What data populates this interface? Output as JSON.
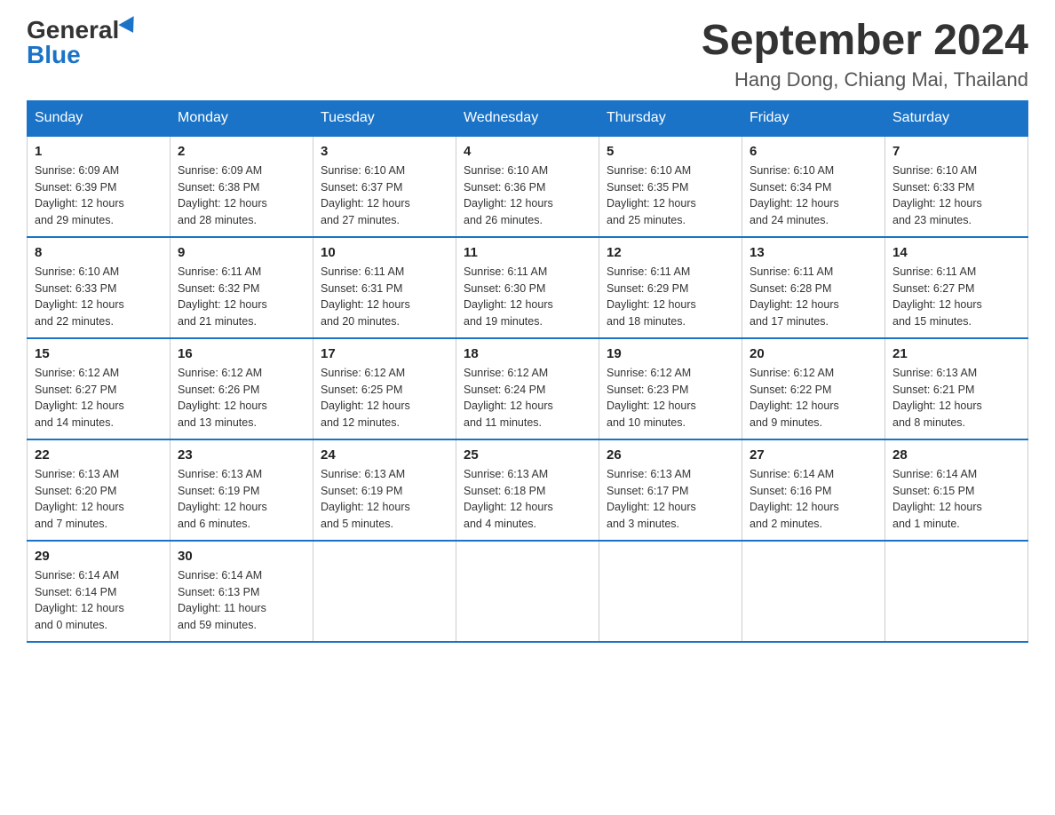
{
  "header": {
    "logo_general": "General",
    "logo_blue": "Blue",
    "month_title": "September 2024",
    "location": "Hang Dong, Chiang Mai, Thailand"
  },
  "weekdays": [
    "Sunday",
    "Monday",
    "Tuesday",
    "Wednesday",
    "Thursday",
    "Friday",
    "Saturday"
  ],
  "weeks": [
    [
      {
        "day": "1",
        "sunrise": "6:09 AM",
        "sunset": "6:39 PM",
        "daylight": "12 hours and 29 minutes."
      },
      {
        "day": "2",
        "sunrise": "6:09 AM",
        "sunset": "6:38 PM",
        "daylight": "12 hours and 28 minutes."
      },
      {
        "day": "3",
        "sunrise": "6:10 AM",
        "sunset": "6:37 PM",
        "daylight": "12 hours and 27 minutes."
      },
      {
        "day": "4",
        "sunrise": "6:10 AM",
        "sunset": "6:36 PM",
        "daylight": "12 hours and 26 minutes."
      },
      {
        "day": "5",
        "sunrise": "6:10 AM",
        "sunset": "6:35 PM",
        "daylight": "12 hours and 25 minutes."
      },
      {
        "day": "6",
        "sunrise": "6:10 AM",
        "sunset": "6:34 PM",
        "daylight": "12 hours and 24 minutes."
      },
      {
        "day": "7",
        "sunrise": "6:10 AM",
        "sunset": "6:33 PM",
        "daylight": "12 hours and 23 minutes."
      }
    ],
    [
      {
        "day": "8",
        "sunrise": "6:10 AM",
        "sunset": "6:33 PM",
        "daylight": "12 hours and 22 minutes."
      },
      {
        "day": "9",
        "sunrise": "6:11 AM",
        "sunset": "6:32 PM",
        "daylight": "12 hours and 21 minutes."
      },
      {
        "day": "10",
        "sunrise": "6:11 AM",
        "sunset": "6:31 PM",
        "daylight": "12 hours and 20 minutes."
      },
      {
        "day": "11",
        "sunrise": "6:11 AM",
        "sunset": "6:30 PM",
        "daylight": "12 hours and 19 minutes."
      },
      {
        "day": "12",
        "sunrise": "6:11 AM",
        "sunset": "6:29 PM",
        "daylight": "12 hours and 18 minutes."
      },
      {
        "day": "13",
        "sunrise": "6:11 AM",
        "sunset": "6:28 PM",
        "daylight": "12 hours and 17 minutes."
      },
      {
        "day": "14",
        "sunrise": "6:11 AM",
        "sunset": "6:27 PM",
        "daylight": "12 hours and 15 minutes."
      }
    ],
    [
      {
        "day": "15",
        "sunrise": "6:12 AM",
        "sunset": "6:27 PM",
        "daylight": "12 hours and 14 minutes."
      },
      {
        "day": "16",
        "sunrise": "6:12 AM",
        "sunset": "6:26 PM",
        "daylight": "12 hours and 13 minutes."
      },
      {
        "day": "17",
        "sunrise": "6:12 AM",
        "sunset": "6:25 PM",
        "daylight": "12 hours and 12 minutes."
      },
      {
        "day": "18",
        "sunrise": "6:12 AM",
        "sunset": "6:24 PM",
        "daylight": "12 hours and 11 minutes."
      },
      {
        "day": "19",
        "sunrise": "6:12 AM",
        "sunset": "6:23 PM",
        "daylight": "12 hours and 10 minutes."
      },
      {
        "day": "20",
        "sunrise": "6:12 AM",
        "sunset": "6:22 PM",
        "daylight": "12 hours and 9 minutes."
      },
      {
        "day": "21",
        "sunrise": "6:13 AM",
        "sunset": "6:21 PM",
        "daylight": "12 hours and 8 minutes."
      }
    ],
    [
      {
        "day": "22",
        "sunrise": "6:13 AM",
        "sunset": "6:20 PM",
        "daylight": "12 hours and 7 minutes."
      },
      {
        "day": "23",
        "sunrise": "6:13 AM",
        "sunset": "6:19 PM",
        "daylight": "12 hours and 6 minutes."
      },
      {
        "day": "24",
        "sunrise": "6:13 AM",
        "sunset": "6:19 PM",
        "daylight": "12 hours and 5 minutes."
      },
      {
        "day": "25",
        "sunrise": "6:13 AM",
        "sunset": "6:18 PM",
        "daylight": "12 hours and 4 minutes."
      },
      {
        "day": "26",
        "sunrise": "6:13 AM",
        "sunset": "6:17 PM",
        "daylight": "12 hours and 3 minutes."
      },
      {
        "day": "27",
        "sunrise": "6:14 AM",
        "sunset": "6:16 PM",
        "daylight": "12 hours and 2 minutes."
      },
      {
        "day": "28",
        "sunrise": "6:14 AM",
        "sunset": "6:15 PM",
        "daylight": "12 hours and 1 minute."
      }
    ],
    [
      {
        "day": "29",
        "sunrise": "6:14 AM",
        "sunset": "6:14 PM",
        "daylight": "12 hours and 0 minutes."
      },
      {
        "day": "30",
        "sunrise": "6:14 AM",
        "sunset": "6:13 PM",
        "daylight": "11 hours and 59 minutes."
      },
      null,
      null,
      null,
      null,
      null
    ]
  ]
}
